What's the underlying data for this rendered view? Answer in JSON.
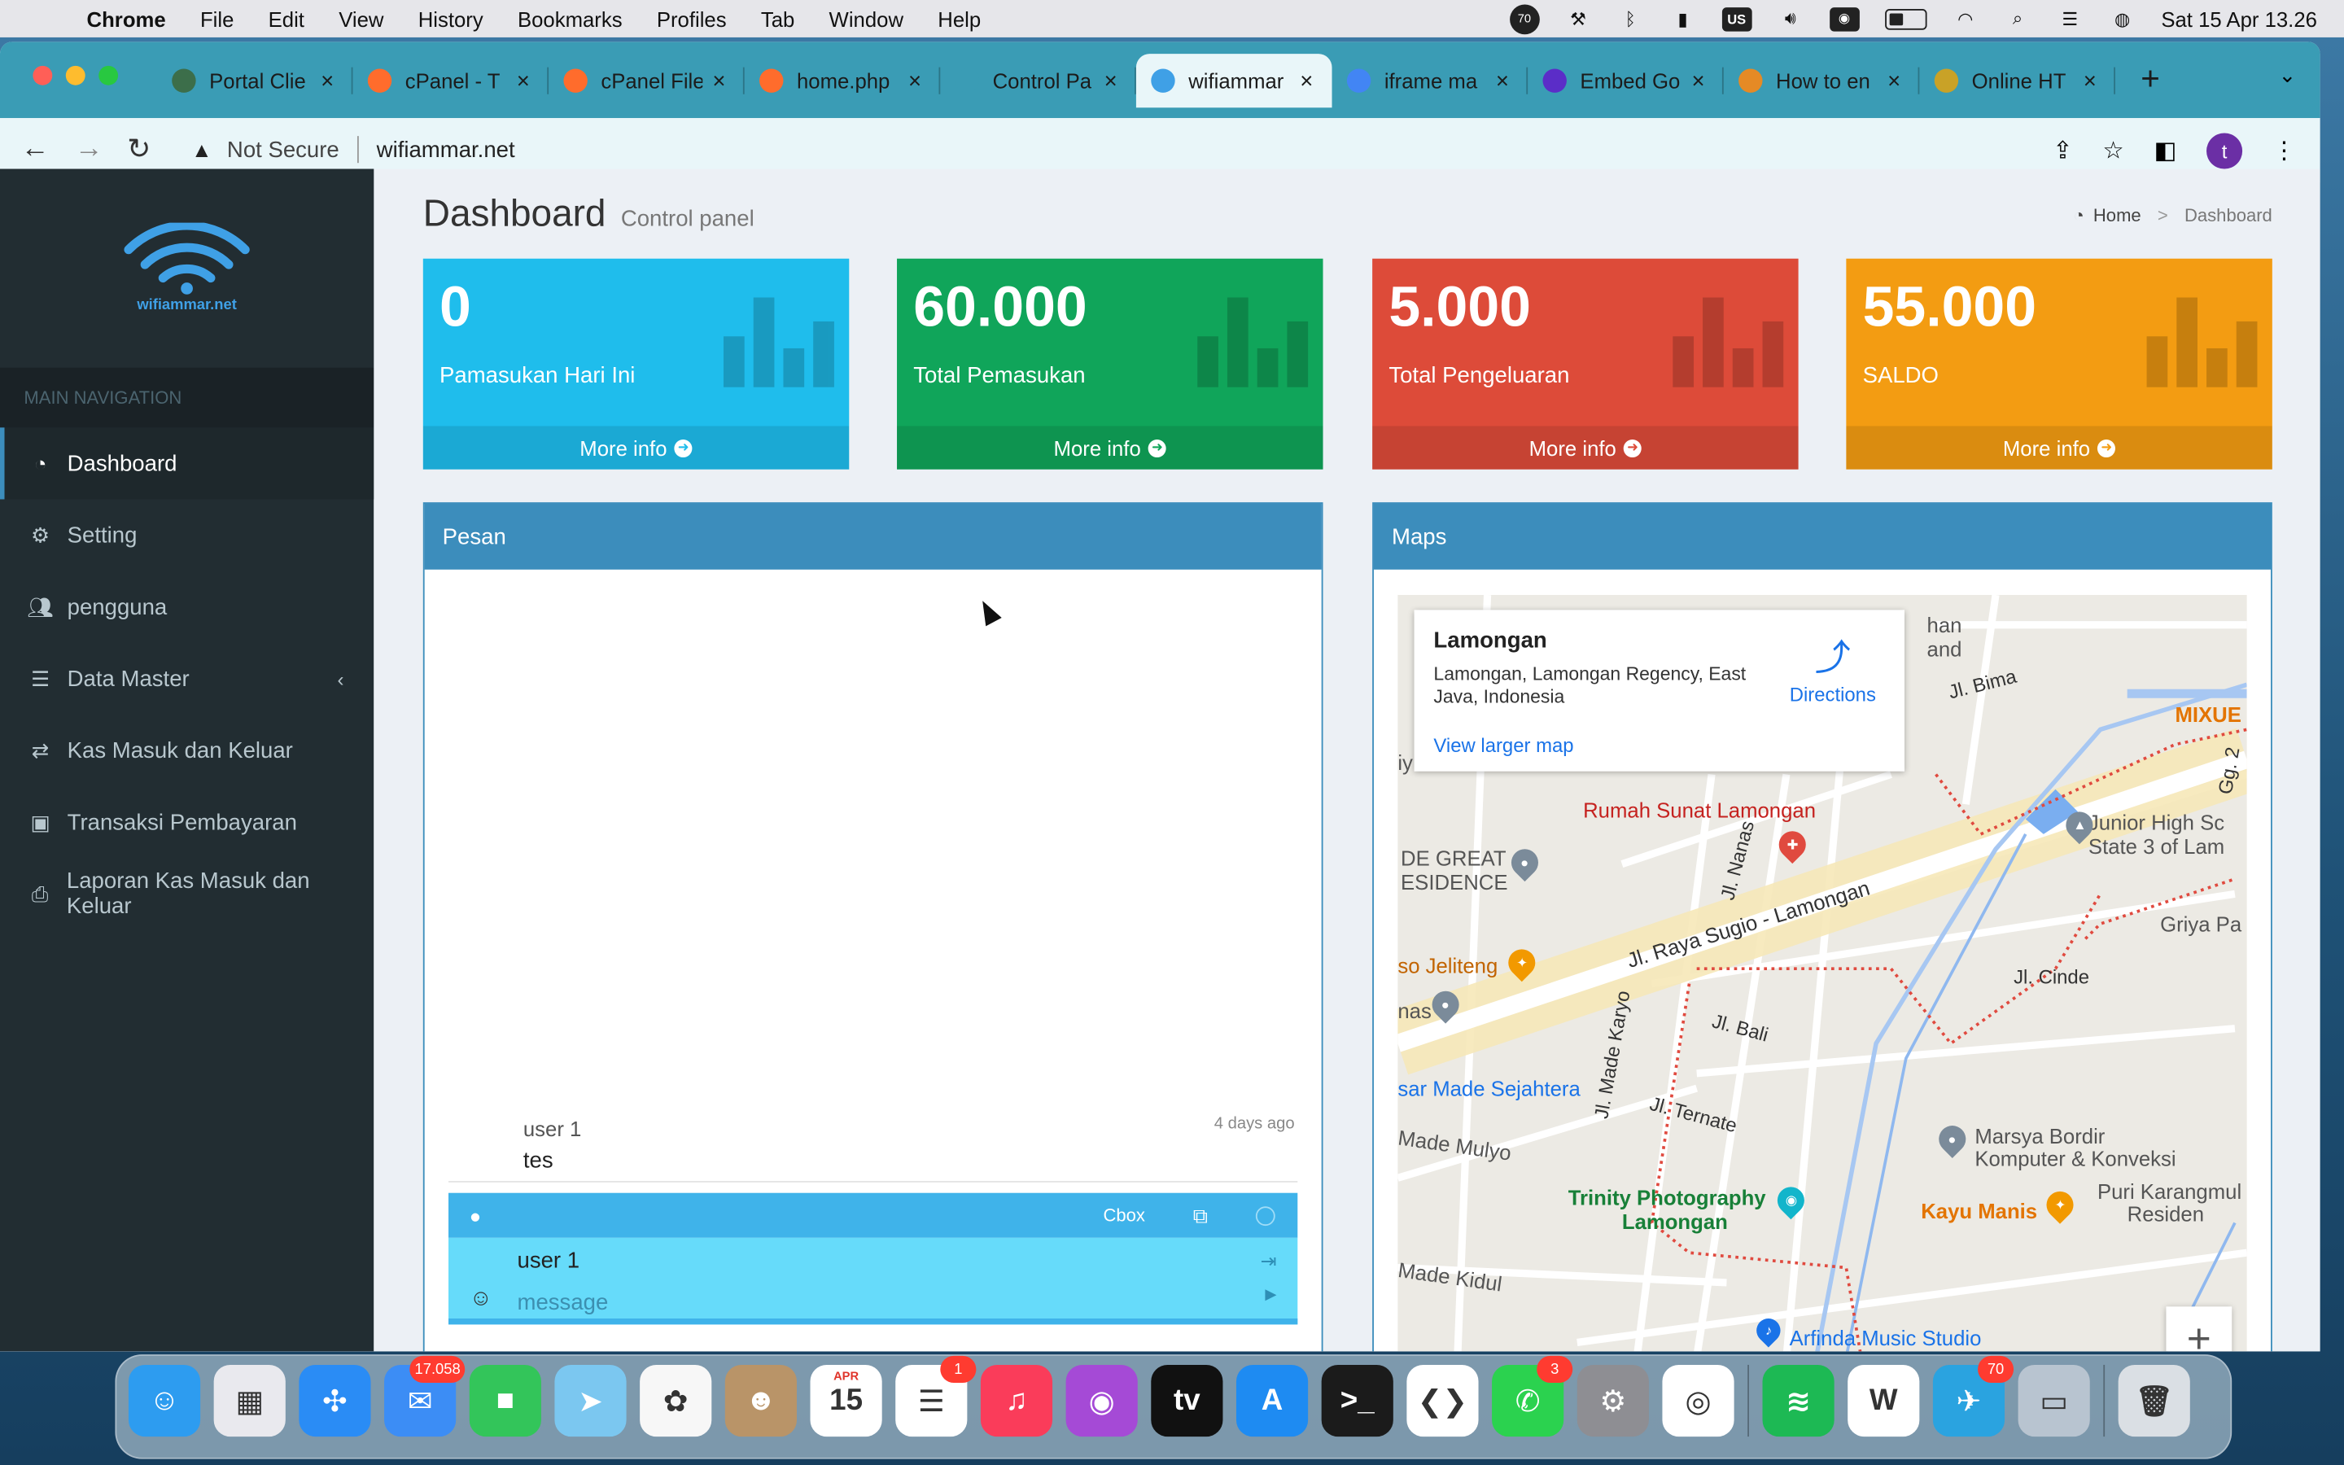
{
  "menubar": {
    "app": "Chrome",
    "items": [
      "File",
      "Edit",
      "View",
      "History",
      "Bookmarks",
      "Profiles",
      "Tab",
      "Window",
      "Help"
    ],
    "status_badge": "70",
    "keyboard": "US",
    "clock": "Sat 15 Apr  13.26"
  },
  "browser": {
    "tabs": [
      {
        "title": "Portal Clie",
        "color": "#3c6e4a"
      },
      {
        "title": "cPanel - T",
        "color": "#ff6c2c"
      },
      {
        "title": "cPanel File",
        "color": "#ff6c2c"
      },
      {
        "title": "home.php",
        "color": "#ff6c2c"
      },
      {
        "title": "Control Pa",
        "color": "#3a9cb5"
      },
      {
        "title": "wifiammar",
        "color": "#3fa0e6"
      },
      {
        "title": "iframe ma",
        "color": "#4285f4"
      },
      {
        "title": "Embed Go",
        "color": "#5b2dc8"
      },
      {
        "title": "How to en",
        "color": "#e58a25"
      },
      {
        "title": "Online HT",
        "color": "#c9a227"
      }
    ],
    "active_tab_index": 5,
    "security_label": "Not Secure",
    "url": "wifiammar.net",
    "profile_initial": "t"
  },
  "sidebar": {
    "logo_text": "wifiammar.net",
    "nav_header": "MAIN NAVIGATION",
    "items": [
      {
        "label": "Dashboard",
        "icon": "dashboard-icon",
        "active": true
      },
      {
        "label": "Setting",
        "icon": "gear-icon"
      },
      {
        "label": "pengguna",
        "icon": "users-icon"
      },
      {
        "label": "Data Master",
        "icon": "list-icon",
        "has_submenu": true
      },
      {
        "label": "Kas Masuk dan Keluar",
        "icon": "exchange-icon"
      },
      {
        "label": "Transaksi Pembayaran",
        "icon": "money-icon"
      },
      {
        "label": "Laporan Kas Masuk dan Keluar",
        "icon": "print-icon"
      }
    ]
  },
  "header": {
    "title": "Dashboard",
    "subtitle": "Control panel",
    "breadcrumb_home": "Home",
    "breadcrumb_current": "Dashboard"
  },
  "stats": [
    {
      "value": "0",
      "label": "Pamasukan Hari Ini",
      "footer": "More info",
      "color": "#1fbdec"
    },
    {
      "value": "60.000",
      "label": "Total Pemasukan",
      "footer": "More info",
      "color": "#10a55a"
    },
    {
      "value": "5.000",
      "label": "Total Pengeluaran",
      "footer": "More info",
      "color": "#dd4b39"
    },
    {
      "value": "55.000",
      "label": "SALDO",
      "footer": "More info",
      "color": "#f39c12"
    }
  ],
  "pesan": {
    "title": "Pesan",
    "message": {
      "user": "user 1",
      "time": "4 days ago",
      "text": "tes"
    },
    "cbox_label": "Cbox",
    "current_user": "user 1",
    "message_placeholder": "message"
  },
  "maps": {
    "title": "Maps",
    "card": {
      "place": "Lamongan",
      "address": "Lamongan, Lamongan Regency, East Java, Indonesia",
      "larger_map": "View larger map",
      "directions": "Directions"
    },
    "labels": {
      "rumah_sunat": "Rumah Sunat Lamongan",
      "de_great": "DE GREAT",
      "esidence": "ESIDENCE",
      "jeliteng": "so Jeliteng",
      "nas": "nas",
      "raya_sugio": "Jl. Raya Sugio - Lamongan",
      "nanas": "Jl. Nanas",
      "bima": "Jl. Bima",
      "mixue": "MIXUE",
      "junior_1": "Junior High Sc",
      "junior_2": "State 3 of Lam",
      "griya": "Griya Pa",
      "cinde": "Jl. Cinde",
      "bali": "Jl. Bali",
      "made_karyo": "Jl. Made Karyo",
      "made_sejahtera": "sar Made Sejahtera",
      "ternate": "Jl. Ternate",
      "made_mulyo": "Made Mulyo",
      "marsya_1": "Marsya Bordir",
      "marsya_2": "Komputer & Konveksi",
      "trinity_1": "Trinity Photography",
      "trinity_2": "Lamongan",
      "kayu_manis": "Kayu Manis",
      "puri_1": "Puri Karangmul",
      "puri_2": "Residen",
      "made_kidul": "Made Kidul",
      "arfinda": "Arfinda Music Studio",
      "han": "han",
      "and": "and",
      "gg2": "Gg. 2",
      "iy": "iy"
    },
    "zoom_in": "+"
  },
  "dock": [
    {
      "name": "finder-icon",
      "color": "#2d9cf0",
      "glyph": "☺"
    },
    {
      "name": "launchpad-icon",
      "color": "#e9e9ee",
      "glyph": "▦"
    },
    {
      "name": "safari-icon",
      "color": "#2a8cf5",
      "glyph": "✣"
    },
    {
      "name": "mail-icon",
      "color": "#3c8df5",
      "glyph": "✉",
      "badge": "17.058"
    },
    {
      "name": "facetime-icon",
      "color": "#33c55a",
      "glyph": "■"
    },
    {
      "name": "maps-icon",
      "color": "#7bc7f0",
      "glyph": "➤"
    },
    {
      "name": "photos-icon",
      "color": "#f7f7f7",
      "glyph": "✿"
    },
    {
      "name": "contacts-icon",
      "color": "#b99468",
      "glyph": "☻"
    },
    {
      "name": "calendar-icon",
      "color": "#ffffff",
      "glyph": "15",
      "top": "APR"
    },
    {
      "name": "reminders-icon",
      "color": "#ffffff",
      "glyph": "☰",
      "badge": "1"
    },
    {
      "name": "music-icon",
      "color": "#fa3c5a",
      "glyph": "♫"
    },
    {
      "name": "podcasts-icon",
      "color": "#a54ad6",
      "glyph": "◉"
    },
    {
      "name": "tv-icon",
      "color": "#111111",
      "glyph": "tv"
    },
    {
      "name": "appstore-icon",
      "color": "#1e8bf2",
      "glyph": "A"
    },
    {
      "name": "terminal-icon",
      "color": "#1b1b1b",
      "glyph": ">_"
    },
    {
      "name": "vscode-icon",
      "color": "#ffffff",
      "glyph": "❮❯"
    },
    {
      "name": "whatsapp-icon",
      "color": "#2bd24f",
      "glyph": "✆",
      "badge": "3"
    },
    {
      "name": "settings-icon",
      "color": "#8e8e93",
      "glyph": "⚙"
    },
    {
      "name": "chrome-icon",
      "color": "#ffffff",
      "glyph": "◎"
    },
    {
      "name": "spotify-icon",
      "color": "#1db954",
      "glyph": "≋"
    },
    {
      "name": "wps-icon",
      "color": "#ffffff",
      "glyph": "W"
    },
    {
      "name": "telegram-icon",
      "color": "#2aa3e0",
      "glyph": "✈",
      "badge": "70"
    },
    {
      "name": "preview-icon",
      "color": "#b8c4d0",
      "glyph": "▭"
    },
    {
      "name": "trash-icon",
      "color": "#dadfe4",
      "glyph": "🗑"
    }
  ]
}
